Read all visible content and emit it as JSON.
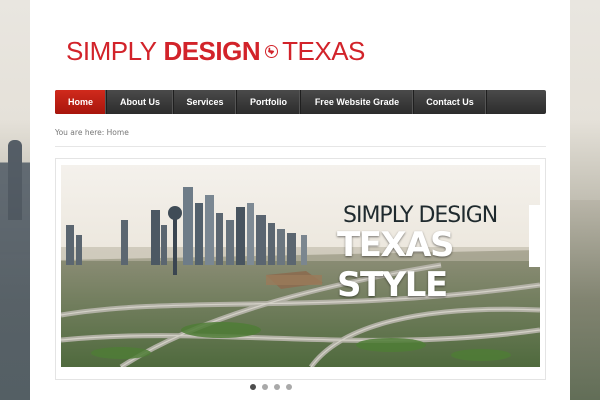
{
  "logo": {
    "part1": "SIMPLY",
    "part2": "DESIGN",
    "part3": "TEXAS",
    "color": "#d2232a",
    "emblem_icon": "texas-map-icon"
  },
  "nav": {
    "items": [
      {
        "label": "Home",
        "active": true
      },
      {
        "label": "About Us",
        "active": false
      },
      {
        "label": "Services",
        "active": false
      },
      {
        "label": "Portfolio",
        "active": false
      },
      {
        "label": "Free Website Grade",
        "active": false
      },
      {
        "label": "Contact Us",
        "active": false
      }
    ],
    "active_color": "#c0221a"
  },
  "breadcrumb": {
    "prefix": "You are here:",
    "current": "Home"
  },
  "slider": {
    "headline_line1": "SIMPLY DESIGN",
    "headline_line2": "TEXAS STYLE",
    "dots_count": 4,
    "active_dot": 1
  }
}
